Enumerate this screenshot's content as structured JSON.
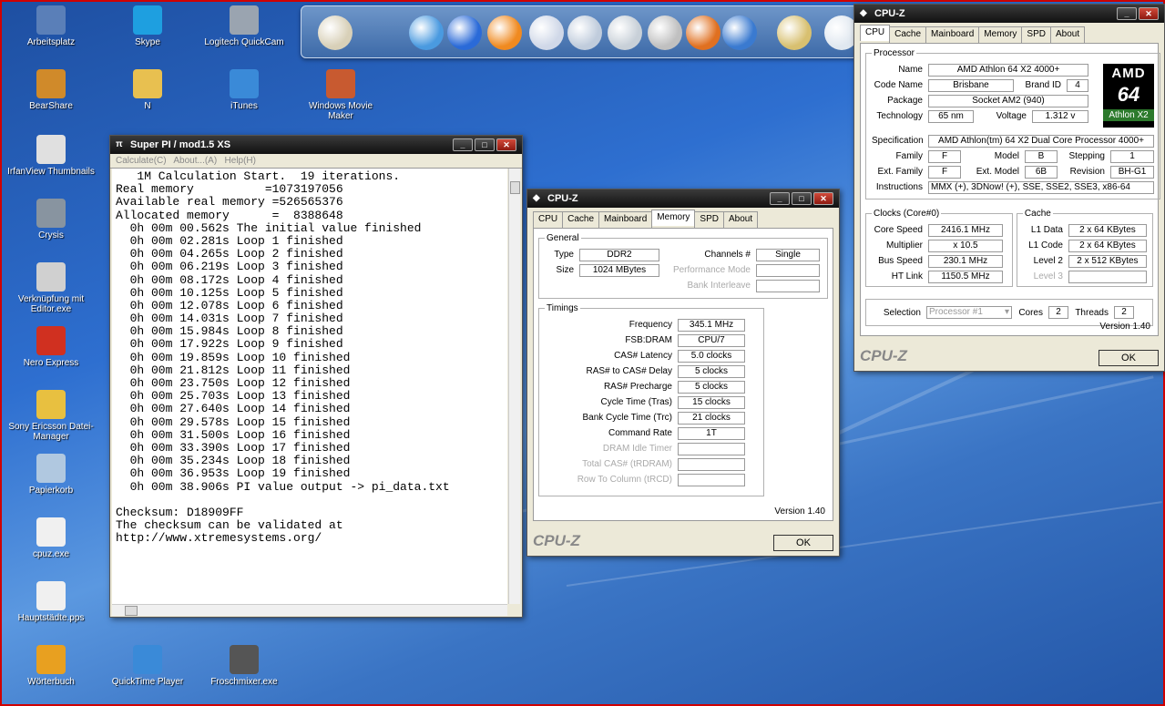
{
  "desktop_icons": [
    {
      "label": "Arbeitsplatz",
      "icon": "computer-icon",
      "color": "#5a7fb8"
    },
    {
      "label": "Skype",
      "icon": "skype-icon",
      "color": "#1e9fe0"
    },
    {
      "label": "Logitech QuickCam",
      "icon": "webcam-icon",
      "color": "#9aa4b0"
    },
    {
      "label": "BearShare",
      "icon": "bear-icon",
      "color": "#d08a2a"
    },
    {
      "label": "N",
      "icon": "folder-icon",
      "color": "#e8c050"
    },
    {
      "label": "iTunes",
      "icon": "itunes-icon",
      "color": "#3a8ad8"
    },
    {
      "label": "Windows Movie Maker",
      "icon": "movie-maker-icon",
      "color": "#c85a30"
    },
    {
      "label": "IrfanView Thumbnails",
      "icon": "panda-icon",
      "color": "#e0e0e0"
    },
    {
      "label": "Crysis",
      "icon": "crysis-icon",
      "color": "#8894a0"
    },
    {
      "label": "Verknüpfung mit Editor.exe",
      "icon": "editor-icon",
      "color": "#d0d0d0"
    },
    {
      "label": "Nero Express",
      "icon": "nero-icon",
      "color": "#d03020"
    },
    {
      "label": "Sony Ericsson Datei-Manager",
      "icon": "phone-icon",
      "color": "#e8c040"
    },
    {
      "label": "Papierkorb",
      "icon": "recycle-bin-icon",
      "color": "#b0c8e0"
    },
    {
      "label": "cpuz.exe",
      "icon": "cpuz-icon",
      "color": "#f0f0f0"
    },
    {
      "label": "Hauptstädte.pps",
      "icon": "pps-icon",
      "color": "#f0f0f0"
    },
    {
      "label": "Wörterbuch",
      "icon": "dictionary-icon",
      "color": "#e8a020"
    },
    {
      "label": "QuickTime Player",
      "icon": "quicktime-icon",
      "color": "#3a8ad8"
    },
    {
      "label": "Froschmixer.exe",
      "icon": "frog-mixer-icon",
      "color": "#555555"
    }
  ],
  "dock_items": [
    {
      "icon": "utilities-icon",
      "color": "#d8d0b8"
    },
    {
      "icon": "itunes-dock-icon",
      "color": "#4a9ae0"
    },
    {
      "icon": "media-player-icon",
      "color": "#2a6ad8"
    },
    {
      "icon": "vlc-icon",
      "color": "#f08a20"
    },
    {
      "icon": "folder-dock-icon",
      "color": "#d0d8e8"
    },
    {
      "icon": "network-folder-icon",
      "color": "#c0ccdc"
    },
    {
      "icon": "usb-drive-icon",
      "color": "#c8d0d8"
    },
    {
      "icon": "drive-icon",
      "color": "#c0c0c0"
    },
    {
      "icon": "firefox-icon",
      "color": "#e07020"
    },
    {
      "icon": "globe-icon",
      "color": "#3a7ad0"
    },
    {
      "icon": "tools-icon",
      "color": "#d8c070"
    },
    {
      "icon": "trash-dock-icon",
      "color": "#e0e8f0"
    }
  ],
  "superpi": {
    "title": "Super PI / mod1.5 XS",
    "menu": [
      "Calculate(C)",
      "About...(A)",
      "Help(H)"
    ],
    "lines": [
      "   1M Calculation Start.  19 iterations.",
      "Real memory          =1073197056",
      "Available real memory =526565376",
      "Allocated memory      =  8388648",
      "  0h 00m 00.562s The initial value finished",
      "  0h 00m 02.281s Loop 1 finished",
      "  0h 00m 04.265s Loop 2 finished",
      "  0h 00m 06.219s Loop 3 finished",
      "  0h 00m 08.172s Loop 4 finished",
      "  0h 00m 10.125s Loop 5 finished",
      "  0h 00m 12.078s Loop 6 finished",
      "  0h 00m 14.031s Loop 7 finished",
      "  0h 00m 15.984s Loop 8 finished",
      "  0h 00m 17.922s Loop 9 finished",
      "  0h 00m 19.859s Loop 10 finished",
      "  0h 00m 21.812s Loop 11 finished",
      "  0h 00m 23.750s Loop 12 finished",
      "  0h 00m 25.703s Loop 13 finished",
      "  0h 00m 27.640s Loop 14 finished",
      "  0h 00m 29.578s Loop 15 finished",
      "  0h 00m 31.500s Loop 16 finished",
      "  0h 00m 33.390s Loop 17 finished",
      "  0h 00m 35.234s Loop 18 finished",
      "  0h 00m 36.953s Loop 19 finished",
      "  0h 00m 38.906s PI value output -> pi_data.txt",
      "",
      "Checksum: D18909FF",
      "The checksum can be validated at",
      "http://www.xtremesystems.org/"
    ]
  },
  "cpuz_mem": {
    "title": "CPU-Z",
    "tabs": [
      "CPU",
      "Cache",
      "Mainboard",
      "Memory",
      "SPD",
      "About"
    ],
    "active_tab": "Memory",
    "general_legend": "General",
    "type_label": "Type",
    "type_value": "DDR2",
    "size_label": "Size",
    "size_value": "1024 MBytes",
    "channels_label": "Channels #",
    "channels_value": "Single",
    "perf_mode_label": "Performance Mode",
    "perf_mode_value": "",
    "bank_interleave_label": "Bank Interleave",
    "bank_interleave_value": "",
    "timings_legend": "Timings",
    "timings": [
      {
        "label": "Frequency",
        "value": "345.1 MHz",
        "dim": false
      },
      {
        "label": "FSB:DRAM",
        "value": "CPU/7",
        "dim": false
      },
      {
        "label": "CAS# Latency",
        "value": "5.0 clocks",
        "dim": false
      },
      {
        "label": "RAS# to CAS# Delay",
        "value": "5 clocks",
        "dim": false
      },
      {
        "label": "RAS# Precharge",
        "value": "5 clocks",
        "dim": false
      },
      {
        "label": "Cycle Time (Tras)",
        "value": "15 clocks",
        "dim": false
      },
      {
        "label": "Bank Cycle Time (Trc)",
        "value": "21 clocks",
        "dim": false
      },
      {
        "label": "Command Rate",
        "value": "1T",
        "dim": false
      },
      {
        "label": "DRAM Idle Timer",
        "value": "",
        "dim": true
      },
      {
        "label": "Total CAS# (tRDRAM)",
        "value": "",
        "dim": true
      },
      {
        "label": "Row To Column (tRCD)",
        "value": "",
        "dim": true
      }
    ],
    "version": "Version 1.40",
    "brand": "CPU-Z",
    "ok_label": "OK"
  },
  "cpuz_cpu": {
    "title": "CPU-Z",
    "tabs": [
      "CPU",
      "Cache",
      "Mainboard",
      "Memory",
      "SPD",
      "About"
    ],
    "active_tab": "CPU",
    "processor_legend": "Processor",
    "name_label": "Name",
    "name_value": "AMD Athlon 64 X2 4000+",
    "codename_label": "Code Name",
    "codename_value": "Brisbane",
    "brandid_label": "Brand ID",
    "brandid_value": "4",
    "package_label": "Package",
    "package_value": "Socket AM2 (940)",
    "technology_label": "Technology",
    "technology_value": "65 nm",
    "voltage_label": "Voltage",
    "voltage_value": "1.312 v",
    "spec_label": "Specification",
    "spec_value": "AMD Athlon(tm) 64 X2 Dual Core Processor 4000+",
    "family_label": "Family",
    "family_value": "F",
    "model_label": "Model",
    "model_value": "B",
    "stepping_label": "Stepping",
    "stepping_value": "1",
    "extfamily_label": "Ext. Family",
    "extfamily_value": "F",
    "extmodel_label": "Ext. Model",
    "extmodel_value": "6B",
    "revision_label": "Revision",
    "revision_value": "BH-G1",
    "instructions_label": "Instructions",
    "instructions_value": "MMX (+), 3DNow! (+), SSE, SSE2, SSE3, x86-64",
    "clocks_legend": "Clocks (Core#0)",
    "corespeed_label": "Core Speed",
    "corespeed_value": "2416.1 MHz",
    "multiplier_label": "Multiplier",
    "multiplier_value": "x 10.5",
    "busspeed_label": "Bus Speed",
    "busspeed_value": "230.1 MHz",
    "htlink_label": "HT Link",
    "htlink_value": "1150.5 MHz",
    "cache_legend": "Cache",
    "l1data_label": "L1 Data",
    "l1data_value": "2 x 64 KBytes",
    "l1code_label": "L1 Code",
    "l1code_value": "2 x 64 KBytes",
    "level2_label": "Level 2",
    "level2_value": "2 x 512 KBytes",
    "level3_label": "Level 3",
    "level3_value": "",
    "selection_label": "Selection",
    "selection_value": "Processor #1",
    "cores_label": "Cores",
    "cores_value": "2",
    "threads_label": "Threads",
    "threads_value": "2",
    "logo_brand": "AMD",
    "logo_mark": "64",
    "logo_model": "Athlon X2",
    "version": "Version 1.40",
    "brand": "CPU-Z",
    "ok_label": "OK"
  }
}
